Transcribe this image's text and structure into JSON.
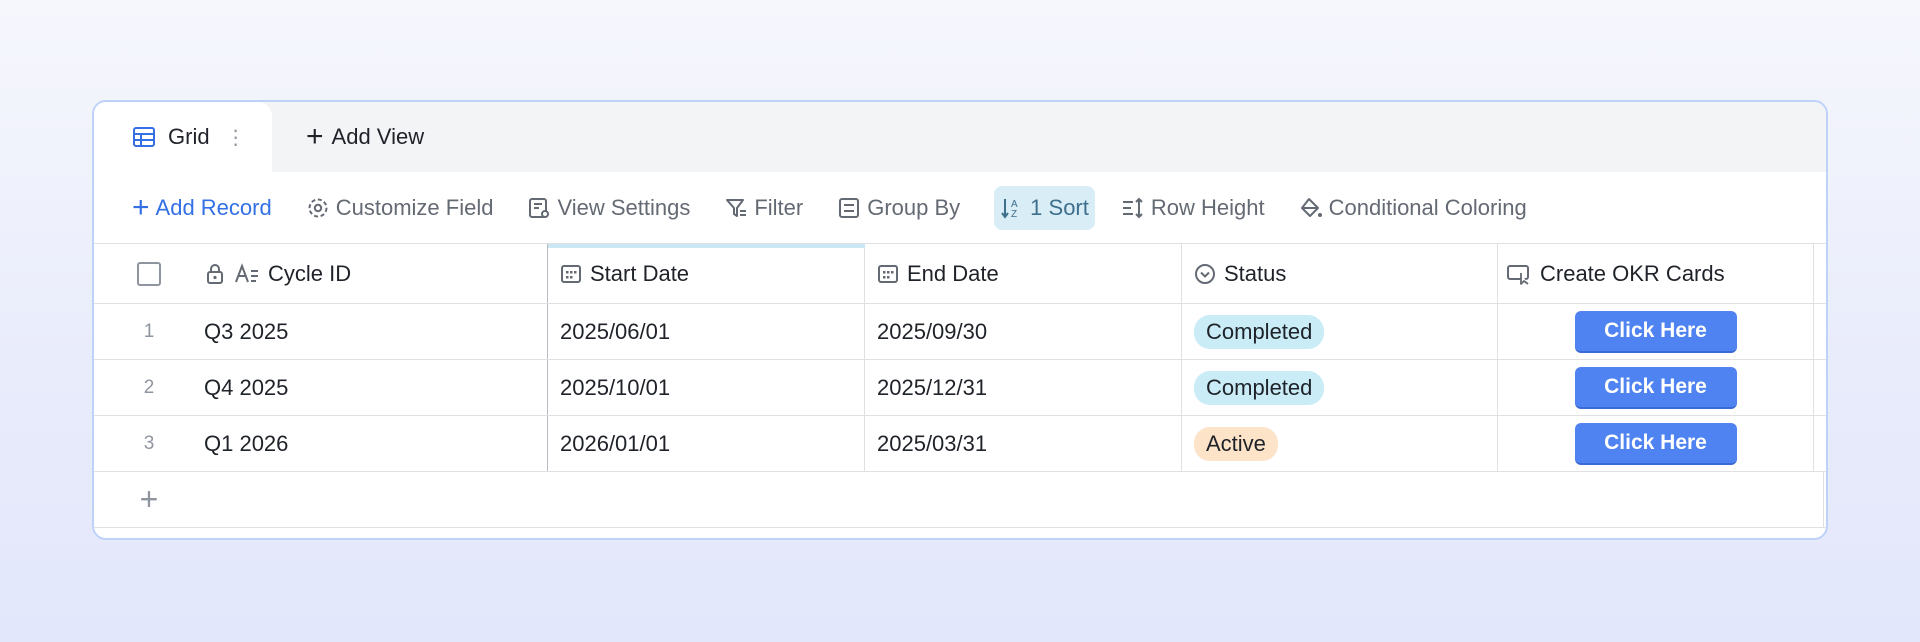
{
  "tabs": {
    "active_label": "Grid",
    "more_glyph": "⋮",
    "add_view_label": "Add View"
  },
  "toolbar": {
    "add_record": "Add Record",
    "customize_field": "Customize Field",
    "view_settings": "View Settings",
    "filter": "Filter",
    "group_by": "Group By",
    "sort": "1 Sort",
    "row_height": "Row Height",
    "conditional_coloring": "Conditional Coloring"
  },
  "columns": {
    "cycle_id": "Cycle ID",
    "start_date": "Start Date",
    "end_date": "End Date",
    "status": "Status",
    "create_okr_cards": "Create OKR Cards"
  },
  "rows": [
    {
      "index": "1",
      "cycle_id": "Q3 2025",
      "start": "2025/06/01",
      "end": "2025/09/30",
      "status": "Completed",
      "status_kind": "done",
      "button": "Click Here"
    },
    {
      "index": "2",
      "cycle_id": "Q4 2025",
      "start": "2025/10/01",
      "end": "2025/12/31",
      "status": "Completed",
      "status_kind": "done",
      "button": "Click Here"
    },
    {
      "index": "3",
      "cycle_id": "Q1 2026",
      "start": "2026/01/01",
      "end": "2025/03/31",
      "status": "Active",
      "status_kind": "active",
      "button": "Click Here"
    }
  ],
  "colors": {
    "accent": "#3370e6",
    "button": "#4f83f1",
    "completed_badge": "#c9ecf7",
    "active_badge": "#fde3c8",
    "sort_highlight": "#d8edf6"
  }
}
